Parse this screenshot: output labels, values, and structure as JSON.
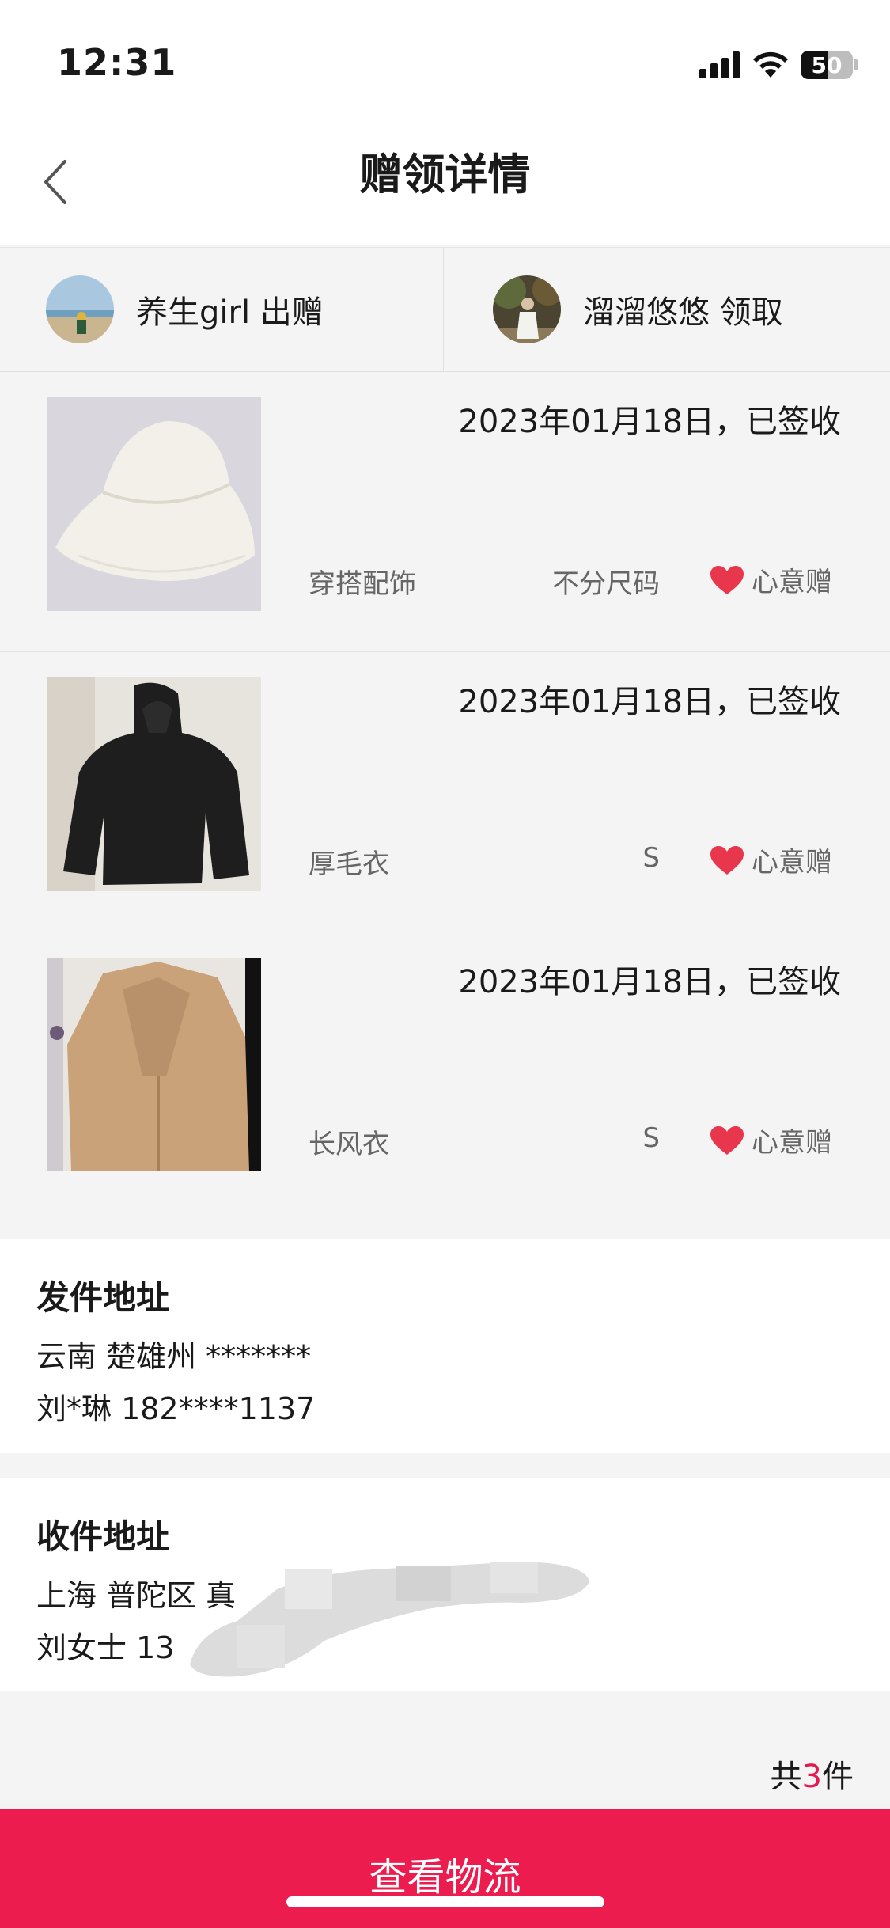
{
  "status_bar": {
    "time": "12:31",
    "battery": "50"
  },
  "nav": {
    "title": "赠领详情"
  },
  "parties": {
    "giver": {
      "text": "养生girl 出赠"
    },
    "receiver": {
      "text": "溜溜悠悠 领取"
    }
  },
  "items": [
    {
      "date": "2023年01月18日，已签收",
      "category": "穿搭配饰",
      "size": "不分尺码",
      "gift_type": "心意赠",
      "image": "white-bucket-hat"
    },
    {
      "date": "2023年01月18日，已签收",
      "category": "厚毛衣",
      "size": "S",
      "gift_type": "心意赠",
      "image": "black-hooded-sweater"
    },
    {
      "date": "2023年01月18日，已签收",
      "category": "长风衣",
      "size": "S",
      "gift_type": "心意赠",
      "image": "beige-trench-coat"
    }
  ],
  "sender_address": {
    "title": "发件地址",
    "line1": "云南 楚雄州 *******",
    "line2": "刘*琳 182****1137"
  },
  "receiver_address": {
    "title": "收件地址",
    "line1": "上海 普陀区 真",
    "line2": "刘女士 13"
  },
  "summary": {
    "prefix": "共",
    "count": "3",
    "suffix": "件"
  },
  "actions": {
    "logistics_label": "查看物流"
  },
  "colors": {
    "accent": "#ec1c4f",
    "heart": "#e8364d"
  }
}
